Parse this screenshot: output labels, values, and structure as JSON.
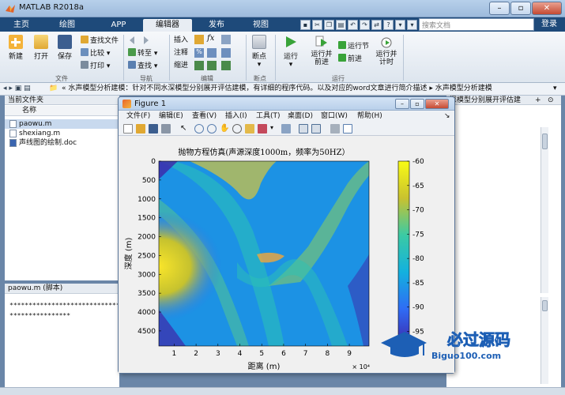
{
  "window": {
    "title": "MATLAB R2018a"
  },
  "tabs": [
    {
      "label": "主页",
      "active": false
    },
    {
      "label": "绘图",
      "active": false
    },
    {
      "label": "APP",
      "active": false
    },
    {
      "label": "编辑器",
      "active": true
    },
    {
      "label": "发布",
      "active": false
    },
    {
      "label": "视图",
      "active": false
    }
  ],
  "search": {
    "placeholder": "搜索文档"
  },
  "login_label": "登录",
  "ribbon": {
    "file": {
      "new": "新建",
      "open": "打开",
      "save": "保存",
      "find_files": "查找文件",
      "compare": "比较",
      "print": "打印",
      "group": "文件"
    },
    "nav": {
      "goto": "转至",
      "find": "查找",
      "group": "导航"
    },
    "edit": {
      "insert": "插入",
      "comment": "注释",
      "indent": "缩进",
      "fx": "fx",
      "group": "编辑"
    },
    "breakpoints": {
      "label": "断点",
      "group": "断点"
    },
    "run": {
      "run": "运行",
      "run_advance": "运行并\n前进",
      "run_section": "运行节",
      "advance": "前进",
      "run_time": "运行并\n计时",
      "group": "运行"
    }
  },
  "address": {
    "path": "«  水声模型分析建模：针对不同水深模型分别展开评估建模，有详细的程序代码。以及对应的word文章进行简介描述  ▸  水声模型分析建模"
  },
  "left_panel": {
    "header": "当前文件夹",
    "col_name": "名称",
    "files": [
      {
        "name": "paowu.m",
        "selected": true
      },
      {
        "name": "shexiang.m",
        "selected": false
      },
      {
        "name": "声线图的绘制.doc",
        "selected": false
      }
    ]
  },
  "editor": {
    "header": "paowu.m  (脚本)",
    "lines": [
      "********************************************",
      "****************"
    ]
  },
  "right_panel": {
    "header": "深模型分别展开评估建"
  },
  "figure": {
    "title": "Figure 1",
    "menu": [
      "文件(F)",
      "编辑(E)",
      "查看(V)",
      "插入(I)",
      "工具(T)",
      "桌面(D)",
      "窗口(W)",
      "帮助(H)"
    ]
  },
  "chart_data": {
    "type": "heatmap",
    "title": "抛物方程仿真(声源深度1000m，频率为50HZ）",
    "xlabel": "距离 (m)",
    "ylabel": "深度 (m)",
    "x_ticks": [
      1,
      2,
      3,
      4,
      5,
      6,
      7,
      8,
      9
    ],
    "x_exponent_label": "× 10⁴",
    "y_ticks": [
      0,
      500,
      1000,
      1500,
      2000,
      2500,
      3000,
      3500,
      4000,
      4500
    ],
    "colorbar_ticks": [
      -60,
      -65,
      -70,
      -75,
      -80,
      -85,
      -90,
      -95
    ],
    "colorbar_range": [
      -98,
      -60
    ],
    "colormap": "parula"
  },
  "watermark": {
    "brand": "必过源码",
    "url": "Biguo100.com"
  },
  "colors": {
    "accent": "#1e4a7a",
    "ribbon_bg": "#e9eef4"
  }
}
